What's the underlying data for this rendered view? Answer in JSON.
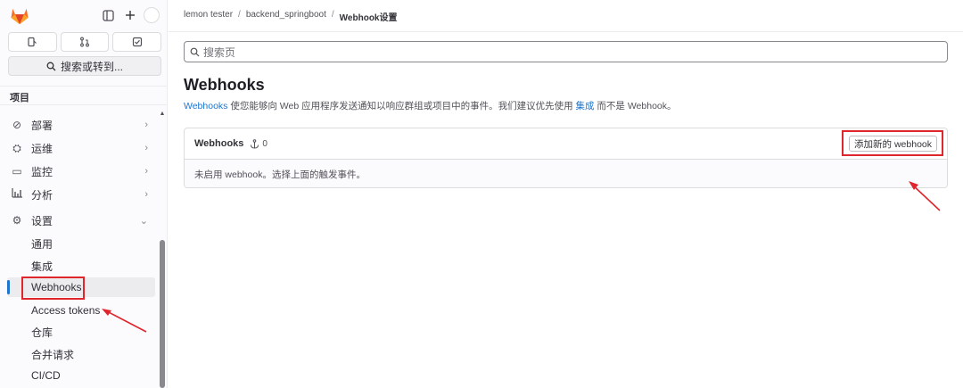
{
  "sidebar": {
    "quick_search": "搜索或转到...",
    "section_title": "项目",
    "nav": [
      {
        "label": "部署",
        "icon": "deploy-icon"
      },
      {
        "label": "运维",
        "icon": "operate-icon"
      },
      {
        "label": "监控",
        "icon": "monitor-icon"
      },
      {
        "label": "分析",
        "icon": "analytics-icon"
      },
      {
        "label": "设置",
        "icon": "settings-icon"
      }
    ],
    "settings_sub": [
      "通用",
      "集成",
      "Webhooks",
      "Access tokens",
      "仓库",
      "合并请求",
      "CI/CD"
    ]
  },
  "breadcrumb": {
    "user": "lemon tester",
    "project": "backend_springboot",
    "current": "Webhook设置"
  },
  "search": {
    "placeholder": "搜索页"
  },
  "page": {
    "title": "Webhooks",
    "desc_link": "Webhooks",
    "desc_mid": " 使您能够向 Web 应用程序发送通知以响应群组或项目中的事件。我们建议优先使用 ",
    "desc_link2": "集成",
    "desc_end": " 而不是 Webhook。"
  },
  "card": {
    "title": "Webhooks",
    "count": "0",
    "add_label": "添加新的 webhook",
    "empty_text": "未启用 webhook。选择上面的触发事件。"
  },
  "colors": {
    "accent": "#1f75cb",
    "highlight": "#e0262d"
  }
}
